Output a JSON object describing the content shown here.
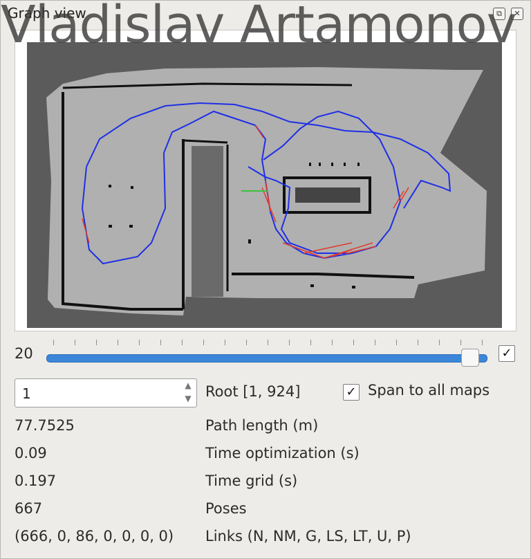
{
  "window": {
    "title": "Graph view",
    "watermark": "Vladislav Artamonov",
    "float_label": "⧉",
    "close_label": "✕"
  },
  "slider": {
    "value": "20",
    "position": 0.98,
    "check_mark": "✓"
  },
  "root": {
    "spin_value": "1",
    "spin_up": "▲",
    "spin_down": "▼",
    "label": "Root [1, 924]",
    "span_check": "✓",
    "span_label": "Span to all maps"
  },
  "stats": [
    {
      "value": "77.7525",
      "label": "Path length (m)"
    },
    {
      "value": "0.09",
      "label": "Time optimization (s)"
    },
    {
      "value": "0.197",
      "label": "Time grid (s)"
    },
    {
      "value": "667",
      "label": "Poses"
    },
    {
      "value": "(666, 0, 86, 0, 0, 0, 0)",
      "label": "Links (N, NM, G, LS, LT, U, P)"
    }
  ],
  "colors": {
    "map_background": "#5b5b5b",
    "free_space": "#b0b0b0",
    "obstacle": "#111111",
    "trajectory": "#1f2fe6",
    "loop_links": "#e23a2a",
    "origin_axis": "#3cc23c",
    "slider_fill": "#3b86d9"
  }
}
